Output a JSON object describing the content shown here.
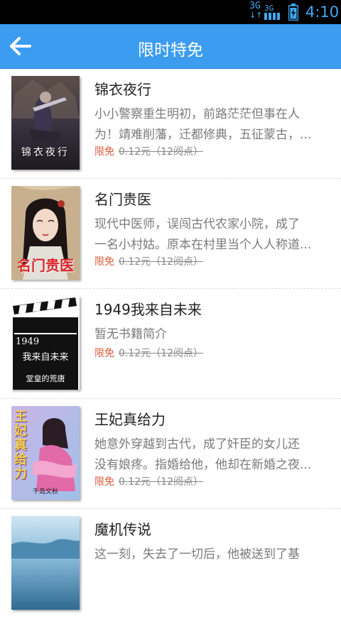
{
  "status_bar": {
    "network": "3G",
    "time": "4:10"
  },
  "header": {
    "title": "限时特免"
  },
  "books": [
    {
      "title": "锦衣夜行",
      "cover_text": "锦衣夜行",
      "desc_line1": "小小警察重生明初，前路茫茫但事在人",
      "desc_line2": "为！靖难削藩，迁都修典，五征蒙古，...",
      "free_label": "限免",
      "old_price": "0.12元（12阅点）"
    },
    {
      "title": "名门贵医",
      "cover_text": "名门贵医",
      "desc_line1": "现代中医师，误闯古代农家小院，成了",
      "desc_line2": "一名小村姑。原本在村里当个人人称道...",
      "free_label": "限免",
      "old_price": "0.12元（12阅点）"
    },
    {
      "title": "1949我来自未来",
      "cover_text_1": "1949",
      "cover_text_2": "我来自未来",
      "cover_text_3": "堂皇的荒唐",
      "desc_line1": "暂无书籍简介",
      "desc_line2": "",
      "free_label": "限免",
      "old_price": "0.12元（12阅点）"
    },
    {
      "title": "王妃真给力",
      "cover_text": "王妃真给力",
      "cover_author": "千岛文秋",
      "desc_line1": "她意外穿越到古代，成了奸臣的女儿还",
      "desc_line2": "没有娘疼。指婚给他，他却在新婚之夜...",
      "free_label": "限免",
      "old_price": "0.12元（12阅点）"
    },
    {
      "title": "魔机传说",
      "desc_line1": "这一刻，失去了一切后，他被送到了基",
      "desc_line2": ""
    }
  ],
  "colors": {
    "header_bg": "#3b9cf0",
    "free_label": "#e25a3a",
    "status_accent": "#3fa9f5"
  }
}
